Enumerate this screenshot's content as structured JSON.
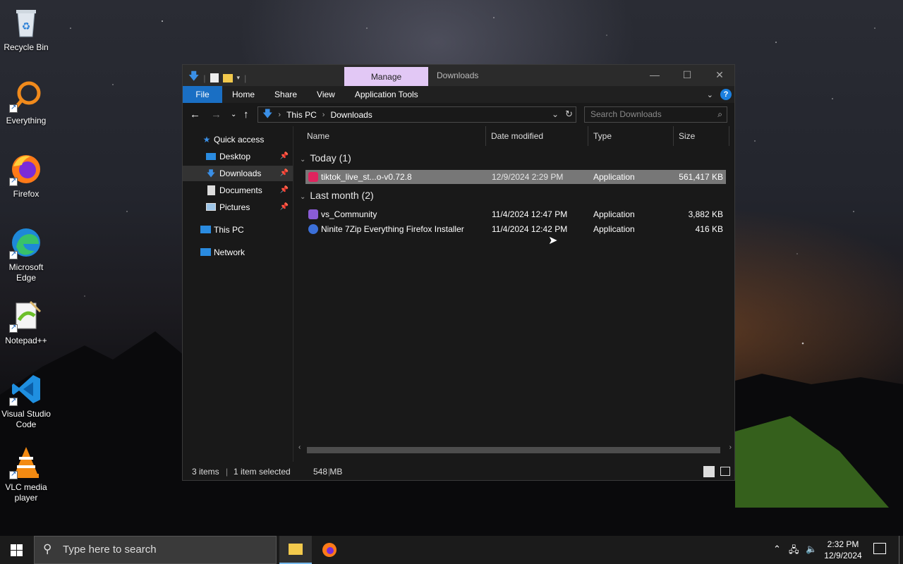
{
  "desktop": {
    "icons": [
      {
        "label": "Recycle Bin",
        "icon": "recycle-bin-icon"
      },
      {
        "label": "Everything",
        "icon": "everything-search-icon"
      },
      {
        "label": "Firefox",
        "icon": "firefox-icon"
      },
      {
        "label": "Microsoft Edge",
        "icon": "edge-icon"
      },
      {
        "label": "Notepad++",
        "icon": "notepadpp-icon"
      },
      {
        "label": "Visual Studio Code",
        "icon": "vscode-icon"
      },
      {
        "label": "VLC media player",
        "icon": "vlc-icon"
      }
    ]
  },
  "window": {
    "contextual_tab": "Manage",
    "title": "Downloads",
    "ribbon_tabs": [
      "File",
      "Home",
      "Share",
      "View",
      "Application Tools"
    ],
    "help": "?",
    "address": {
      "crumbs": [
        "This PC",
        "Downloads"
      ]
    },
    "search_placeholder": "Search Downloads",
    "nav": {
      "quick_access": "Quick access",
      "desktop": "Desktop",
      "downloads": "Downloads",
      "documents": "Documents",
      "pictures": "Pictures",
      "this_pc": "This PC",
      "network": "Network"
    },
    "columns": {
      "name": "Name",
      "date": "Date modified",
      "type": "Type",
      "size": "Size"
    },
    "groups": {
      "today": "Today (1)",
      "last_month": "Last month (2)"
    },
    "files": [
      {
        "name": "tiktok_live_st...o-v0.72.8",
        "date": "12/9/2024 2:29 PM",
        "type": "Application",
        "size": "561,417 KB",
        "selected": true
      },
      {
        "name": "vs_Community",
        "date": "11/4/2024 12:47 PM",
        "type": "Application",
        "size": "3,882 KB"
      },
      {
        "name": "Ninite 7Zip Everything Firefox Installer",
        "date": "11/4/2024 12:42 PM",
        "type": "Application",
        "size": "416 KB"
      }
    ],
    "status": {
      "items": "3 items",
      "selected": "1 item selected",
      "size": "548 MB"
    }
  },
  "taskbar": {
    "search_placeholder": "Type here to search",
    "time": "2:32 PM",
    "date": "12/9/2024"
  },
  "colors": {
    "file_tab": "#1a6fc4",
    "manage_tab": "#e2c8f5",
    "selection": "#777777"
  }
}
